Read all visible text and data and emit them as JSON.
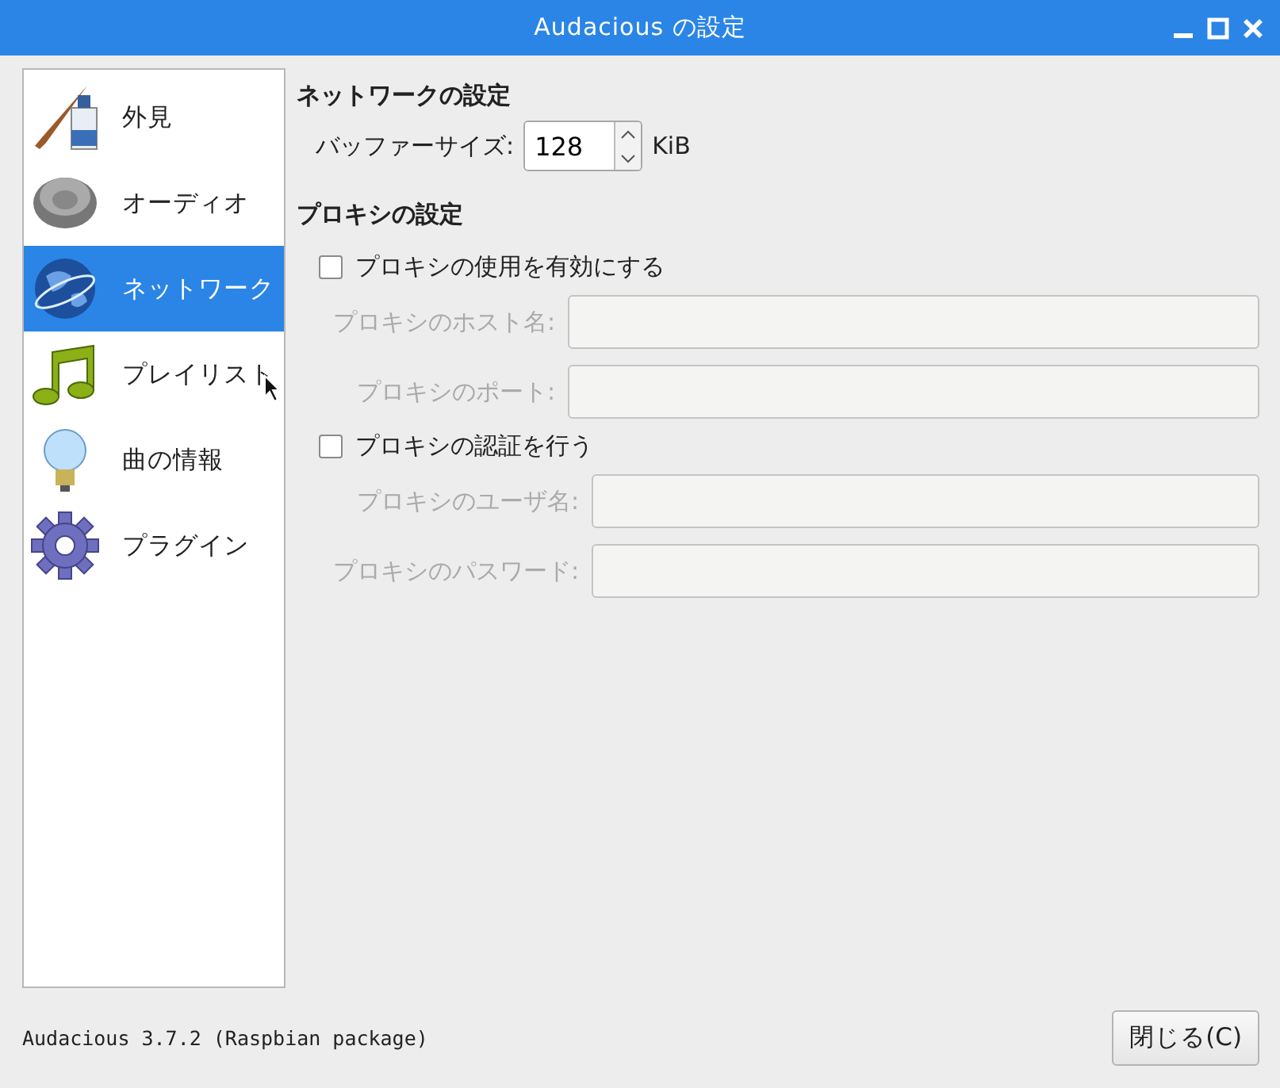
{
  "window": {
    "title": "Audacious の設定"
  },
  "sidebar": {
    "items": [
      {
        "label": "外見",
        "selected": false
      },
      {
        "label": "オーディオ",
        "selected": false
      },
      {
        "label": "ネットワーク",
        "selected": true
      },
      {
        "label": "プレイリスト",
        "selected": false
      },
      {
        "label": "曲の情報",
        "selected": false
      },
      {
        "label": "プラグイン",
        "selected": false
      }
    ]
  },
  "sections": [
    {
      "heading": "ネットワークの設定",
      "rows": [
        {
          "kind": "spin",
          "label": "バッファーサイズ:",
          "value": "128",
          "unit": "KiB"
        }
      ]
    },
    {
      "heading": "プロキシの設定",
      "rows": [
        {
          "kind": "checkbox",
          "label": "プロキシの使用を有効にする",
          "checked": false,
          "fields": [
            {
              "label": "プロキシのホスト名:",
              "disabled": true
            },
            {
              "label": "プロキシのポート:",
              "disabled": true
            }
          ]
        },
        {
          "kind": "checkbox",
          "label": "プロキシの認証を行う",
          "checked": false,
          "fields": [
            {
              "label": "プロキシのユーザ名:",
              "disabled": true
            },
            {
              "label": "プロキシのパスワード:",
              "disabled": true
            }
          ]
        }
      ]
    }
  ],
  "footer": {
    "version": "Audacious 3.7.2 (Raspbian package)",
    "close_button": "閉じる(C)"
  }
}
